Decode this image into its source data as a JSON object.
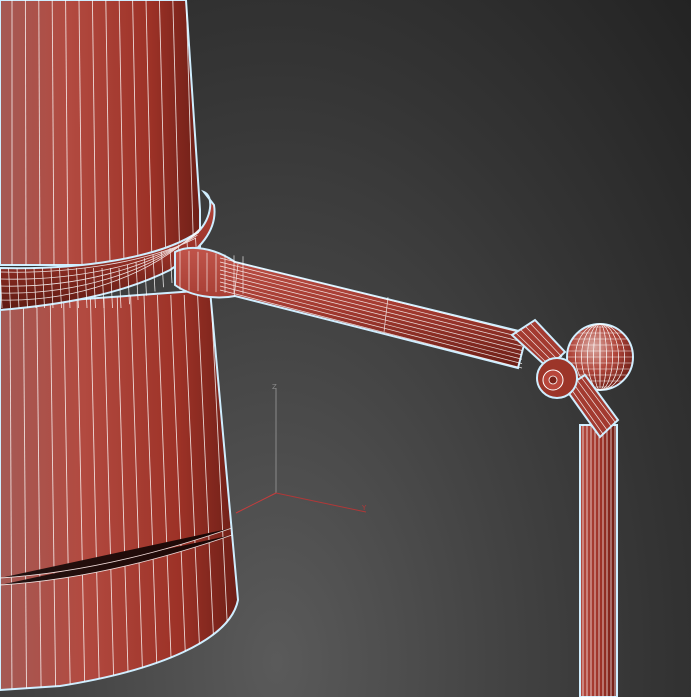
{
  "viewport": {
    "mode": "wireframe-over-shaded",
    "background_color": "#3a3a3a",
    "object_color": "#a83a30",
    "wire_color": "#ffffff",
    "selection_highlight_color": "#bfe6ff"
  },
  "gizmo": {
    "x_label": "",
    "y_label": "Y",
    "z_label": "Z",
    "x_color": "#c83c3c",
    "y_color": "#b03838",
    "z_color": "#8a8a8a"
  },
  "objects": [
    {
      "name": "lamp-base-cone"
    },
    {
      "name": "collar-ring"
    },
    {
      "name": "arm-rod"
    },
    {
      "name": "joint-hub"
    },
    {
      "name": "ball-joint"
    },
    {
      "name": "vertical-pole"
    }
  ]
}
